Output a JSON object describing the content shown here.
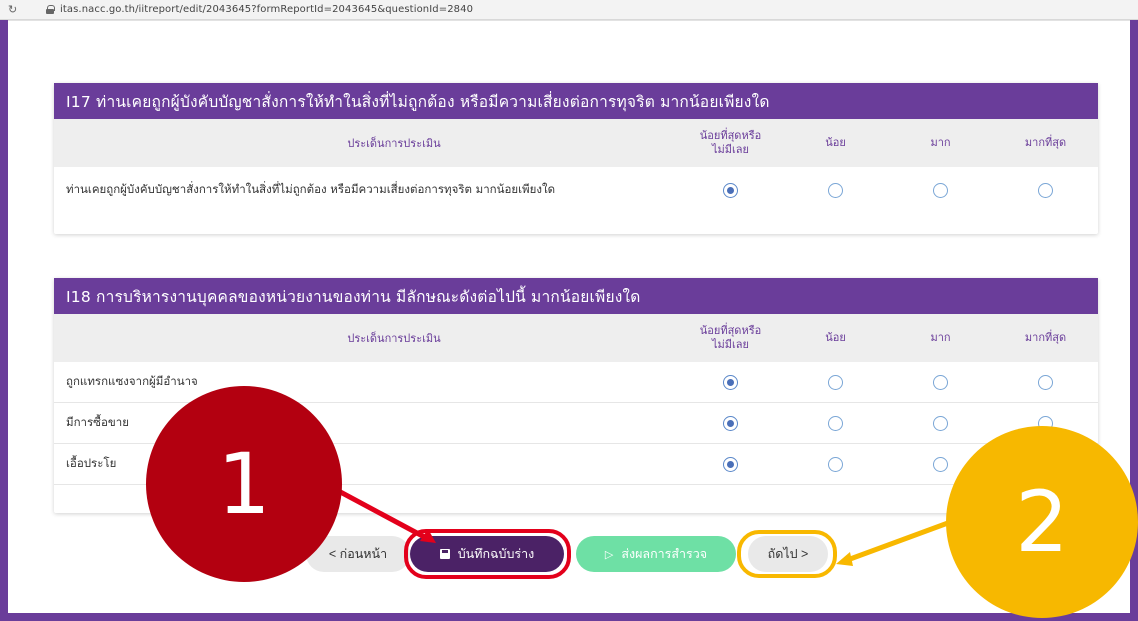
{
  "browser": {
    "url": "itas.nacc.go.th/iitreport/edit/2043645?formReportId=2043645&questionId=2840"
  },
  "table_headers": {
    "criteria": "ประเด็นการประเมิน",
    "col1_line1": "น้อยที่สุดหรือ",
    "col1_line2": "ไม่มีเลย",
    "col2": "น้อย",
    "col3": "มาก",
    "col4": "มากที่สุด"
  },
  "question_i17": {
    "title": "I17 ท่านเคยถูกผู้บังคับบัญชาสั่งการให้ทำในสิ่งที่ไม่ถูกต้อง หรือมีความเสี่ยงต่อการทุจริต มากน้อยเพียงใด",
    "rows": [
      {
        "text": "ท่านเคยถูกผู้บังคับบัญชาสั่งการให้ทำในสิ่งที่ไม่ถูกต้อง หรือมีความเสี่ยงต่อการทุจริต มากน้อยเพียงใด",
        "selected": 0
      }
    ]
  },
  "question_i18": {
    "title": "I18 การบริหารงานบุคคลของหน่วยงานของท่าน มีลักษณะดังต่อไปนี้ มากน้อยเพียงใด",
    "rows": [
      {
        "text": "ถูกแทรกแซงจากผู้มีอำนาจ",
        "selected": 0
      },
      {
        "text": "มีการซื้อขาย",
        "selected": 0
      },
      {
        "text": "เอื้อประโย",
        "selected": 0
      }
    ]
  },
  "nav": {
    "prev_label": "< ก่อนหน้า",
    "save_label": "บันทึกฉบับร่าง",
    "submit_label": "ส่งผลการสำรวจ",
    "next_label": "ถัดไป >"
  },
  "annotations": {
    "callout_1": "1",
    "callout_2": "2",
    "color_1": "#b30010",
    "color_2": "#f7b800"
  },
  "colors": {
    "brand_purple": "#6a3d9a",
    "save_button": "#4b2266",
    "submit_button": "#6ee0a5"
  }
}
